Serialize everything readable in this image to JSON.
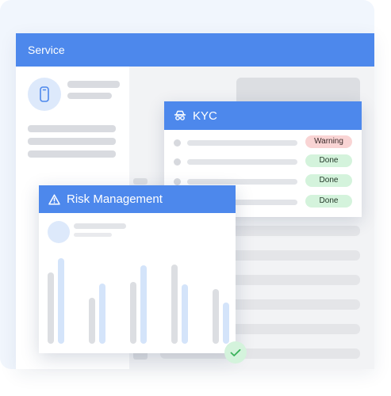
{
  "main": {
    "title": "Service"
  },
  "kyc": {
    "title": "KYC",
    "rows": [
      {
        "status": "Warning",
        "state": "warning"
      },
      {
        "status": "Done",
        "state": "done"
      },
      {
        "status": "Done",
        "state": "done"
      },
      {
        "status": "Done",
        "state": "done"
      }
    ]
  },
  "risk": {
    "title": "Risk Management"
  },
  "icons": {
    "avatar": "phone-icon",
    "kyc": "spy-icon",
    "risk": "warning-icon",
    "status": "check-icon"
  },
  "colors": {
    "accent": "#4d88ec",
    "warning_bg": "#f9d4d4",
    "done_bg": "#d4f3dc",
    "chart_grey": "#d9dbe0",
    "chart_blue": "#d4e4fa"
  }
}
